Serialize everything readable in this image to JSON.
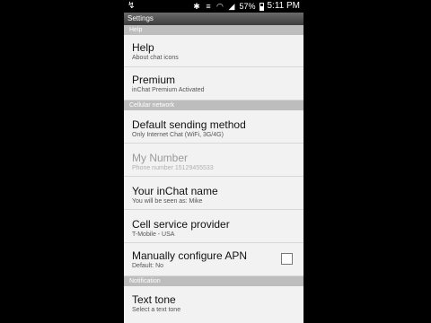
{
  "status_bar": {
    "left_icon": "usb-plug-icon",
    "icons": [
      "bluetooth-icon",
      "vibrate-icon",
      "wifi-icon",
      "signal-icon",
      "battery-icon"
    ],
    "battery_text": "57%",
    "time": "5:11 PM"
  },
  "title_bar": {
    "title": "Settings"
  },
  "sections": [
    {
      "header": "Help",
      "items": [
        {
          "title": "Help",
          "subtitle": "About chat icons"
        },
        {
          "title": "Premium",
          "subtitle": "inChat Premium Activated"
        }
      ]
    },
    {
      "header": "Cellular network",
      "items": [
        {
          "title": "Default sending method",
          "subtitle": "Only Internet Chat (WiFi, 3G/4G)"
        },
        {
          "title": "My Number",
          "subtitle": "Phone number 15129455533",
          "disabled": true
        },
        {
          "title": "Your inChat name",
          "subtitle": "You will be seen as: Mike"
        },
        {
          "title": "Cell service provider",
          "subtitle": "T-Mobile - USA"
        },
        {
          "title": "Manually configure APN",
          "subtitle": "Default: No",
          "checkbox": false
        }
      ]
    },
    {
      "header": "Notification",
      "items": [
        {
          "title": "Text tone",
          "subtitle": "Select a text tone"
        }
      ]
    }
  ]
}
